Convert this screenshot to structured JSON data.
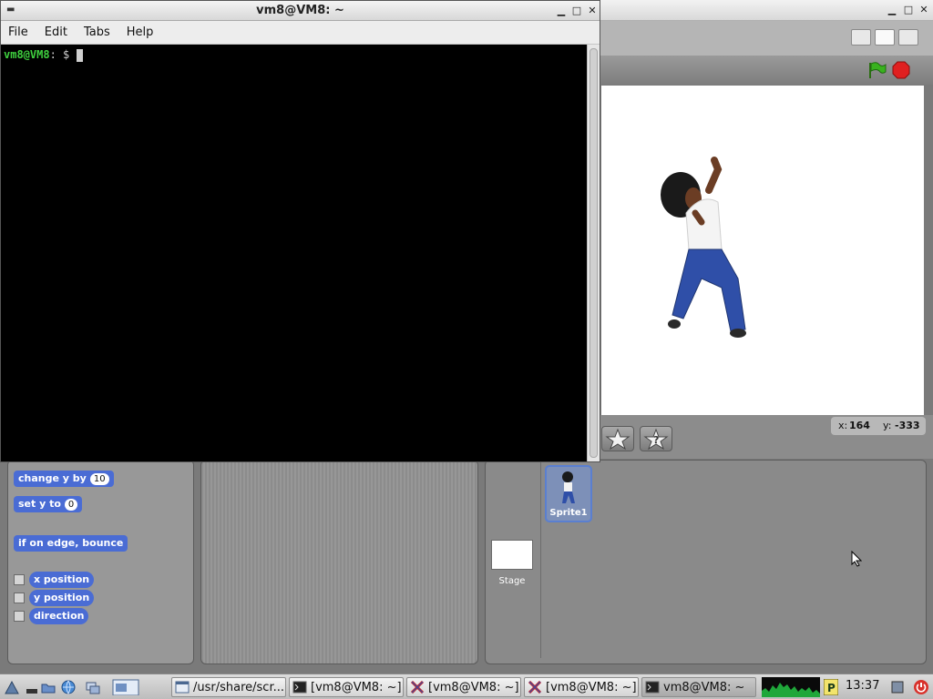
{
  "terminal": {
    "title": "vm8@VM8: ~",
    "menu": [
      "File",
      "Edit",
      "Tabs",
      "Help"
    ],
    "prompt_user": "vm8@VM8",
    "prompt_sep": ":",
    "prompt_tail": " $ "
  },
  "scratch": {
    "coords": {
      "x_label": "x:",
      "x_value": "164",
      "y_label": "y:",
      "y_value": "-333"
    },
    "blocks": {
      "change_y_label": "change y by",
      "change_y_value": "10",
      "set_y_label": "set y to",
      "set_y_value": "0",
      "edge_bounce": "if on edge, bounce",
      "x_position": "x position",
      "y_position": "y position",
      "direction": "direction"
    },
    "sprite_name": "Sprite1",
    "stage_label": "Stage"
  },
  "taskbar": {
    "tasks": [
      "/usr/share/scr...",
      "[vm8@VM8: ~]",
      "[vm8@VM8: ~]",
      "[vm8@VM8: ~]",
      "vm8@VM8: ~"
    ],
    "clock": "13:37"
  }
}
